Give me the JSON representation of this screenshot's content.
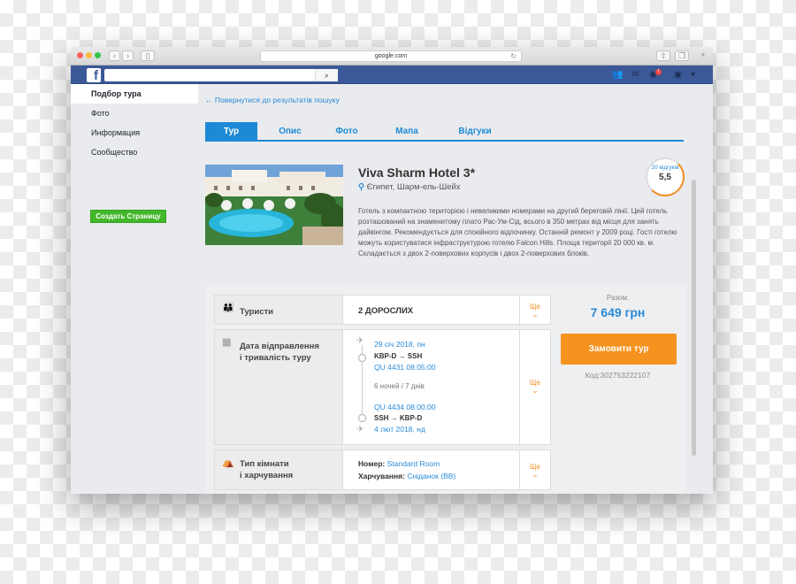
{
  "browser": {
    "url": "google.com"
  },
  "facebook": {
    "logo": "f",
    "search_icon": "search-icon",
    "nav_icons": [
      "friends-icon",
      "messages-icon",
      "globe-icon",
      "help-icon",
      "chevron-down-icon"
    ],
    "notifications": "1"
  },
  "sidebar": {
    "items": [
      {
        "label": "Подбор тура"
      },
      {
        "label": "Фото"
      },
      {
        "label": "Информация"
      },
      {
        "label": "Сообщество"
      }
    ],
    "create_page": "Создать Страницу"
  },
  "back_link": "← Повернутися до результатів пошуку",
  "tabs": [
    {
      "label": "Тур"
    },
    {
      "label": "Опис"
    },
    {
      "label": "Фото"
    },
    {
      "label": "Мапа"
    },
    {
      "label": "Відгуки"
    }
  ],
  "hotel": {
    "name": "Viva Sharm Hotel 3*",
    "location": "Єгипет, Шарм-ель-Шейх",
    "description": "Готель з компактною територією і невеликими номерами на другий береговій лінії. Цей готель розташований на знаменитому плато Рас-Ум-Сід, всього в 350 метрах від місця для занять дайвінгом. Рекомендується для спокійного відпочинку. Останній ремонт у 2009 році. Гості готелю можуть користуватися інфраструктурою готелю Falcon Hills. Площа території 20 000 кв. м. Складається з двох 2-поверхових корпусів і двох 2-поверхових блоків.",
    "reviews": "20 відгуків",
    "score": "5,5"
  },
  "booking": {
    "tourists": {
      "label": "Туристи",
      "value": "2 ДОРОСЛИХ",
      "change": "Ще"
    },
    "dates": {
      "label_1": "Дата відправлення",
      "label_2": "і тривалість туру",
      "depart_date": "29 січ 2018, пн",
      "depart_route": "KBP-D → SSH",
      "depart_flight": "QU 4431 08:05:00",
      "duration": "6 ночей / 7 днів",
      "return_flight": "QU 4434 08:00:00",
      "return_route": "SSH → KBP-D",
      "return_date": "4 лют 2018, нд",
      "change": "Ще"
    },
    "room": {
      "label_1": "Тип кімнати",
      "label_2": "і харчування",
      "room_label": "Номер:",
      "room_value": "Standard Room",
      "meal_label": "Харчування:",
      "meal_value": "Сніданок (BB)",
      "change": "Ще"
    },
    "total_label": "Разом:",
    "total": "7 649 грн",
    "order_button": "Замовити тур",
    "code": "Код:302753222107"
  },
  "colors": {
    "fb_blue": "#3b5998",
    "accent_blue": "#1e8ad6",
    "orange": "#f6921e",
    "green": "#42b72a"
  }
}
